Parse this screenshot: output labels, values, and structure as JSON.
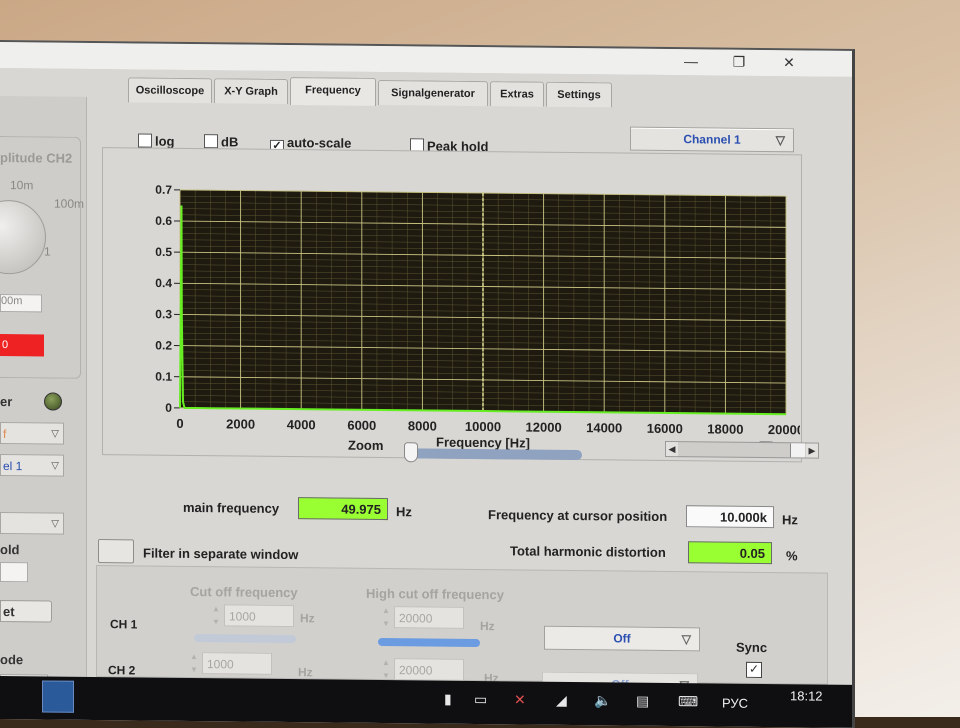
{
  "tabs": [
    "Oscilloscope",
    "X-Y Graph",
    "Frequency",
    "Signalgenerator",
    "Extras",
    "Settings"
  ],
  "active_tab": "Frequency",
  "window_controls": {
    "minimize": "—",
    "restore": "❐",
    "close": "✕"
  },
  "left_panel": {
    "amplitude_title": "plitude CH2",
    "knob_labels": [
      "10m",
      "100m",
      "1"
    ],
    "knob_field": "00m",
    "red_value": "0",
    "trigger_label": "er",
    "trigger_drop": "f",
    "channel_drop": "el 1",
    "hold_label": "old",
    "reset_btn": "et",
    "mode_label": "ode"
  },
  "options": {
    "log": {
      "label": "log",
      "checked": false
    },
    "db": {
      "label": "dB",
      "checked": false
    },
    "autoscale": {
      "label": "auto-scale",
      "checked": true
    },
    "peakhold": {
      "label": "Peak hold",
      "checked": false
    },
    "channel": "Channel 1"
  },
  "zoom_label": "Zoom",
  "xlog_label": "log",
  "main_frequency": {
    "label": "main frequency",
    "value": "49.975",
    "unit": "Hz"
  },
  "cursor_frequency": {
    "label": "Frequency at cursor position",
    "value": "10.000k",
    "unit": "Hz"
  },
  "thd": {
    "label": "Total harmonic distortion",
    "value": "0.05",
    "unit": "%"
  },
  "filter_window": {
    "label": "Filter in separate window"
  },
  "filter_panel": {
    "cutoff_header": "Cut off frequency",
    "high_cutoff_header": "High cut off frequency",
    "ch1": {
      "label": "CH 1",
      "cutoff": "1000",
      "high_cutoff": "20000",
      "unit": "Hz",
      "mode": "Off"
    },
    "ch2": {
      "label": "CH 2",
      "cutoff": "1000",
      "high_cutoff": "20000",
      "unit": "Hz",
      "mode": "Off"
    },
    "sync_label": "Sync"
  },
  "taskbar": {
    "lang": "РУС",
    "time": "18:12"
  },
  "chart_data": {
    "type": "line",
    "title": "",
    "xlabel": "Frequency [Hz]",
    "ylabel": "",
    "xlim": [
      0,
      20000
    ],
    "ylim": [
      0,
      0.7
    ],
    "x_ticks": [
      "0",
      "2000",
      "4000",
      "6000",
      "8000",
      "10000",
      "12000",
      "14000",
      "16000",
      "18000",
      "20000"
    ],
    "y_ticks": [
      "0",
      "0.1",
      "0.2",
      "0.3",
      "0.4",
      "0.5",
      "0.6",
      "0.7"
    ],
    "grid": true,
    "cursor_x": 10000,
    "colors": {
      "background": "#1e1a10",
      "grid": "#c8c280",
      "trace": "#66ee22",
      "cursor": "#f0f0a0"
    },
    "series": [
      {
        "x": [
          0,
          50,
          60,
          100,
          150,
          200,
          500,
          1000,
          5000,
          10000,
          15000,
          20000
        ],
        "y": [
          0,
          0.65,
          0.3,
          0.02,
          0.0,
          0.0,
          0.0,
          0.0,
          0.0,
          0.0,
          0.0,
          0.0
        ]
      }
    ]
  }
}
